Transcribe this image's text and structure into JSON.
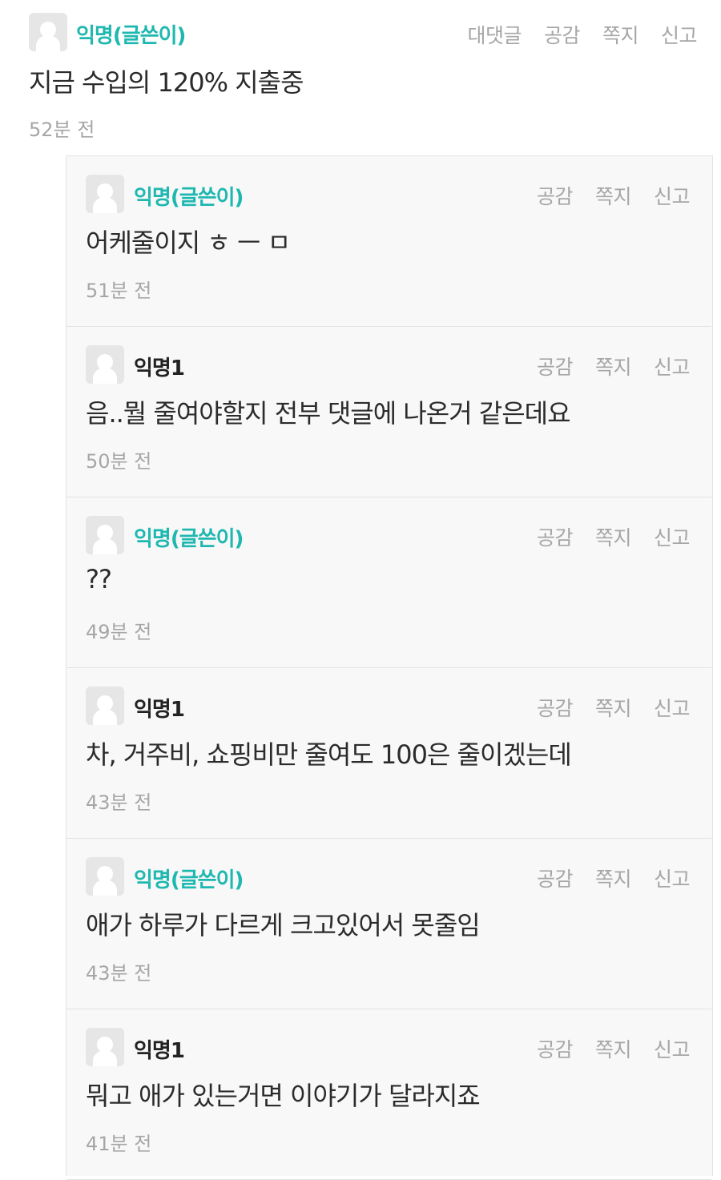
{
  "top_comment": {
    "author": "익명(글쓴이)",
    "text": "지금 수입의 120% 지출중",
    "time": "52분 전",
    "actions": [
      "대댓글",
      "공감",
      "쪽지",
      "신고"
    ]
  },
  "replies": [
    {
      "author": "익명(글쓴이)",
      "is_op": true,
      "text": "어케줄이지 ㅎ ㅡ ㅁ",
      "time": "51분 전",
      "actions": [
        "공감",
        "쪽지",
        "신고"
      ]
    },
    {
      "author": "익명1",
      "is_op": false,
      "text": "음..뭘 줄여야할지 전부 댓글에 나온거 같은데요",
      "time": "50분 전",
      "actions": [
        "공감",
        "쪽지",
        "신고"
      ]
    },
    {
      "author": "익명(글쓴이)",
      "is_op": true,
      "text": "??",
      "time": "49분 전",
      "actions": [
        "공감",
        "쪽지",
        "신고"
      ]
    },
    {
      "author": "익명1",
      "is_op": false,
      "text": "차, 거주비, 쇼핑비만 줄여도 100은 줄이겠는데",
      "time": "43분 전",
      "actions": [
        "공감",
        "쪽지",
        "신고"
      ]
    },
    {
      "author": "익명(글쓴이)",
      "is_op": true,
      "text": "애가 하루가 다르게 크고있어서 못줄임",
      "time": "43분 전",
      "actions": [
        "공감",
        "쪽지",
        "신고"
      ]
    },
    {
      "author": "익명1",
      "is_op": false,
      "text": "뭐고 애가 있는거면 이야기가 달라지죠",
      "time": "41분 전",
      "actions": [
        "공감",
        "쪽지",
        "신고"
      ]
    }
  ],
  "colors": {
    "op_author": "#1fb8b0",
    "author": "#222222",
    "muted": "#a6a6a6",
    "reply_bg": "#f8f8f8",
    "border": "#e3e3e3"
  },
  "icons": {
    "avatar": "default-user-avatar-icon"
  }
}
